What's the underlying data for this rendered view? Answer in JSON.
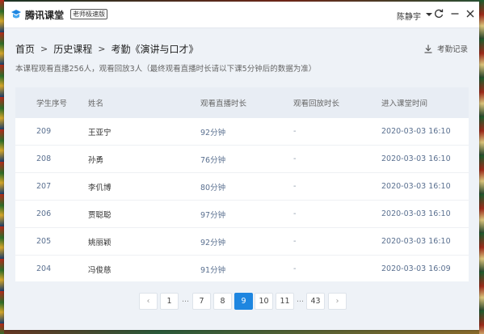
{
  "app": {
    "name": "腾讯课堂",
    "edition": "老师极速版",
    "user": "陈静宇"
  },
  "breadcrumb": {
    "home": "首页",
    "history": "历史课程",
    "current": "考勤《演讲与口才》"
  },
  "export_label": "考勤记录",
  "summary": "本课程观看直播256人，观看回放3人（最终观看直播时长请以下课5分钟后的数据为准）",
  "table": {
    "headers": {
      "student_no": "学生序号",
      "name": "姓名",
      "live_duration": "观看直播时长",
      "replay_duration": "观看回放时长",
      "join_time": "进入课堂时间"
    },
    "rows": [
      {
        "no": "209",
        "name": "王亚宁",
        "live": "92分钟",
        "replay": "-",
        "time": "2020-03-03 16:10"
      },
      {
        "no": "208",
        "name": "孙勇",
        "live": "76分钟",
        "replay": "-",
        "time": "2020-03-03 16:10"
      },
      {
        "no": "207",
        "name": "李仉博",
        "live": "80分钟",
        "replay": "-",
        "time": "2020-03-03 16:10"
      },
      {
        "no": "206",
        "name": "贾聪聪",
        "live": "97分钟",
        "replay": "-",
        "time": "2020-03-03 16:10"
      },
      {
        "no": "205",
        "name": "姚丽颖",
        "live": "92分钟",
        "replay": "-",
        "time": "2020-03-03 16:10"
      },
      {
        "no": "204",
        "name": "冯俊慈",
        "live": "91分钟",
        "replay": "-",
        "time": "2020-03-03 16:09"
      }
    ]
  },
  "pagination": {
    "prev": "‹",
    "next": "›",
    "p1": "1",
    "p7": "7",
    "p8": "8",
    "p9": "9",
    "p10": "10",
    "p11": "11",
    "p43": "43",
    "ellipsis": "...",
    "current": 9
  },
  "colors": {
    "accent": "#1e86e0",
    "logo": "#1e86e0"
  }
}
